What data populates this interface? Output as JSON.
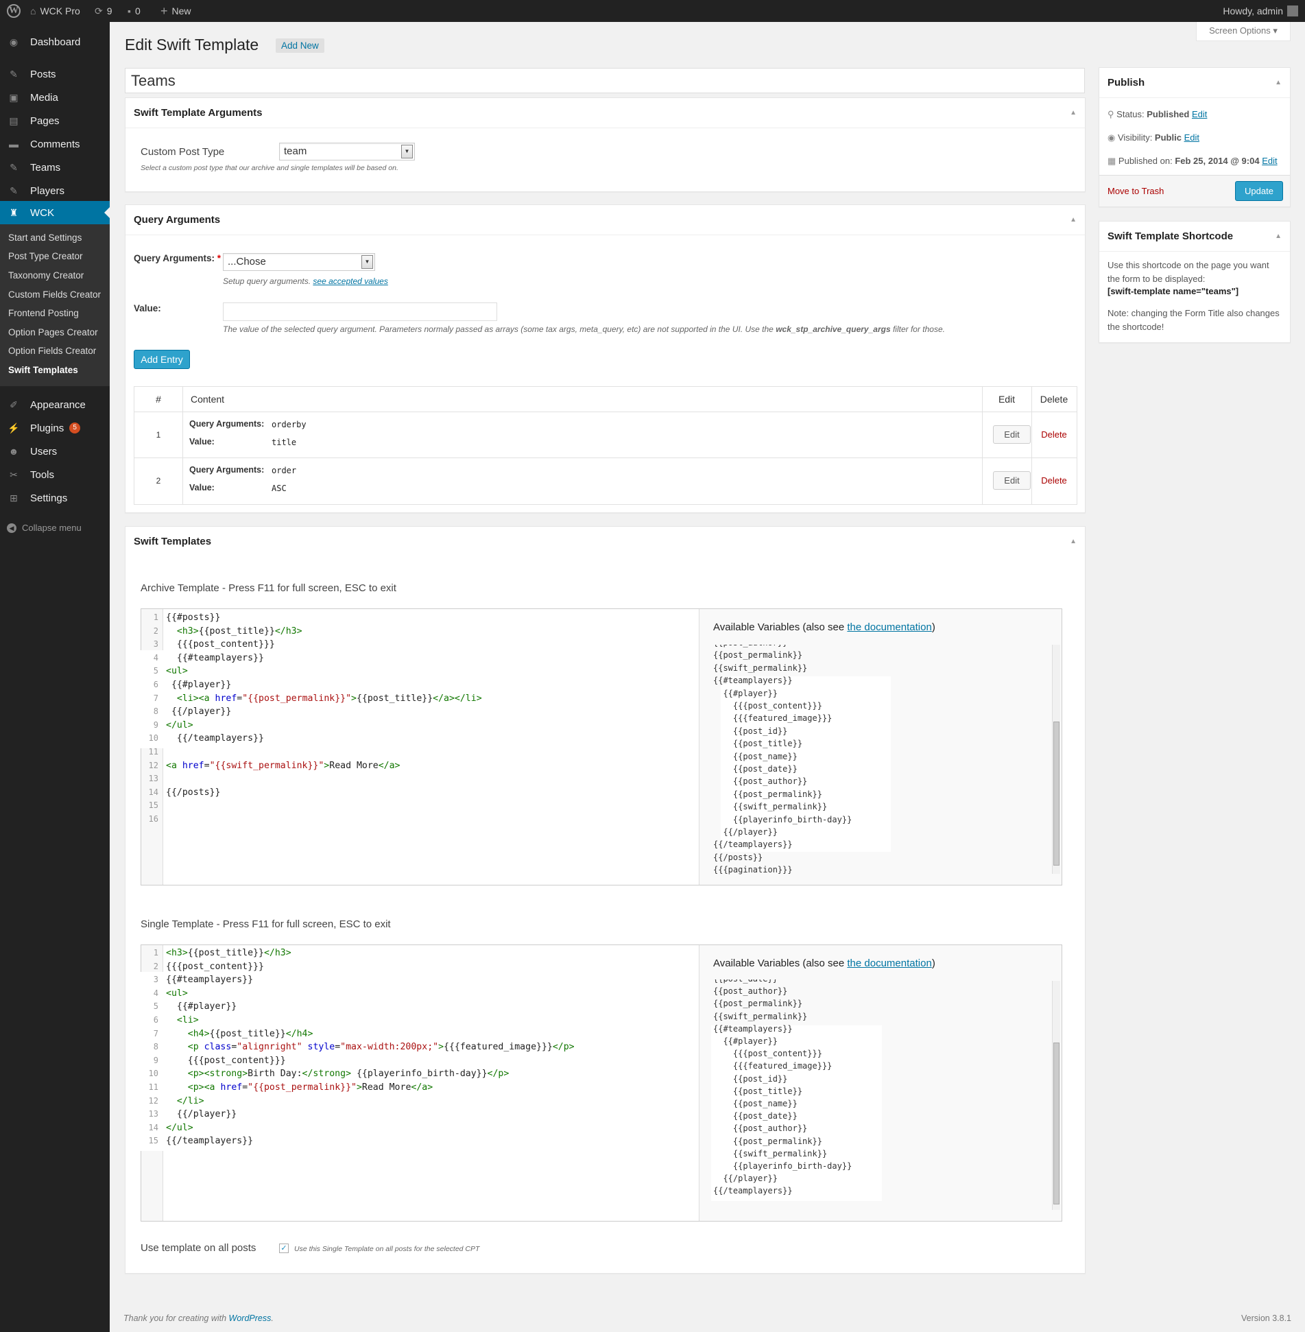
{
  "admin_bar": {
    "site_name": "WCK Pro",
    "updates_count": "9",
    "comments_count": "0",
    "new_label": "New",
    "howdy": "Howdy, admin"
  },
  "sidebar": {
    "items": [
      {
        "label": "Dashboard",
        "icon": "dashboard-icon"
      },
      {
        "label": "Posts",
        "icon": "pin-icon"
      },
      {
        "label": "Media",
        "icon": "media-icon"
      },
      {
        "label": "Pages",
        "icon": "pages-icon"
      },
      {
        "label": "Comments",
        "icon": "comment-icon"
      },
      {
        "label": "Teams",
        "icon": "pin-icon"
      },
      {
        "label": "Players",
        "icon": "pin-icon"
      },
      {
        "label": "WCK",
        "icon": "wck-icon"
      }
    ],
    "submenu": [
      "Start and Settings",
      "Post Type Creator",
      "Taxonomy Creator",
      "Custom Fields Creator",
      "Frontend Posting",
      "Option Pages Creator",
      "Option Fields Creator",
      "Swift Templates"
    ],
    "items_after": [
      {
        "label": "Appearance",
        "icon": "brush-icon"
      },
      {
        "label": "Plugins",
        "icon": "plugin-icon",
        "badge": "5"
      },
      {
        "label": "Users",
        "icon": "users-icon"
      },
      {
        "label": "Tools",
        "icon": "tools-icon"
      },
      {
        "label": "Settings",
        "icon": "settings-icon"
      }
    ],
    "collapse": "Collapse menu"
  },
  "header": {
    "title": "Edit Swift Template",
    "add_new": "Add New",
    "screen_options": "Screen Options"
  },
  "post_title": "Teams",
  "template_args": {
    "title": "Swift Template Arguments",
    "cpt_label": "Custom Post Type",
    "cpt_value": "team",
    "cpt_desc": "Select a custom post type that our archive and single templates will be based on."
  },
  "query_args": {
    "title": "Query Arguments",
    "field_label": "Query Arguments:",
    "required": "*",
    "select_value": "...Chose",
    "desc_prefix": "Setup query arguments. ",
    "desc_link": "see accepted values",
    "value_label": "Value:",
    "value_desc_a": "The value of the selected query argument. Parameters normaly passed as arrays (some tax args, meta_query, etc) are not supported in the UI. Use the ",
    "value_desc_b": "wck_stp_archive_query_args",
    "value_desc_c": " filter for those.",
    "add_entry": "Add Entry",
    "table_headers": [
      "#",
      "Content",
      "Edit",
      "Delete"
    ],
    "rows": [
      {
        "num": "1",
        "arg_label": "Query Arguments:",
        "arg": "orderby",
        "val_label": "Value:",
        "val": "title",
        "edit": "Edit",
        "delete": "Delete"
      },
      {
        "num": "2",
        "arg_label": "Query Arguments:",
        "arg": "order",
        "val_label": "Value:",
        "val": "ASC",
        "edit": "Edit",
        "delete": "Delete"
      }
    ]
  },
  "swift_templates": {
    "title": "Swift Templates",
    "archive_label": "Archive Template - Press F11 for full screen, ESC to exit",
    "single_label": "Single Template - Press F11 for full screen, ESC to exit",
    "vars_prefix": "Available Variables (also see ",
    "vars_link": "the documentation",
    "vars_suffix": ")",
    "use_all_label": "Use template on all posts",
    "use_all_desc": "Use this Single Template on all posts for the selected CPT"
  },
  "archive_code": [
    "{{#posts}}",
    "  <h3>{{post_title}}</h3>",
    "  {{{post_content}}}",
    "  {{#teamplayers}}",
    "<ul>",
    " {{#player}}",
    "  <li><a href=\"{{post_permalink}}\">{{post_title}}</a></li>",
    " {{/player}}",
    "</ul>",
    "  {{/teamplayers}}",
    "",
    "<a href=\"{{swift_permalink}}\">Read More</a>",
    "",
    "{{/posts}}",
    "",
    ""
  ],
  "archive_vars": [
    "{{post_author}}",
    "{{post_permalink}}",
    "{{swift_permalink}}",
    "{{#teamplayers}}",
    "  {{#player}}",
    "    {{{post_content}}}",
    "    {{{featured_image}}}",
    "    {{post_id}}",
    "    {{post_title}}",
    "    {{post_name}}",
    "    {{post_date}}",
    "    {{post_author}}",
    "    {{post_permalink}}",
    "    {{swift_permalink}}",
    "    {{playerinfo_birth-day}}",
    "  {{/player}}",
    "{{/teamplayers}}",
    "{{/posts}}",
    "{{{pagination}}}"
  ],
  "single_code": [
    "<h3>{{post_title}}</h3>",
    "{{{post_content}}}",
    "{{#teamplayers}}",
    "<ul>",
    "  {{#player}}",
    "  <li>",
    "    <h4>{{post_title}}</h4>",
    "    <p class=\"alignright\" style=\"max-width:200px;\">{{{featured_image}}}</p>",
    "    {{{post_content}}}",
    "    <p><strong>Birth Day:</strong> {{playerinfo_birth-day}}</p>",
    "    <p><a href=\"{{post_permalink}}\">Read More</a>",
    "  </li>",
    "  {{/player}}",
    "</ul>",
    "{{/teamplayers}}"
  ],
  "single_vars": [
    "{{post_date}}",
    "{{post_author}}",
    "{{post_permalink}}",
    "{{swift_permalink}}",
    "{{#teamplayers}}",
    "  {{#player}}",
    "    {{{post_content}}}",
    "    {{{featured_image}}}",
    "    {{post_id}}",
    "    {{post_title}}",
    "    {{post_name}}",
    "    {{post_date}}",
    "    {{post_author}}",
    "    {{post_permalink}}",
    "    {{swift_permalink}}",
    "    {{playerinfo_birth-day}}",
    "  {{/player}}",
    "{{/teamplayers}}"
  ],
  "publish": {
    "title": "Publish",
    "status_label": "Status: ",
    "status_value": "Published",
    "visibility_label": "Visibility: ",
    "visibility_value": "Public",
    "published_label": "Published on: ",
    "published_value": "Feb 25, 2014 @ 9:04",
    "edit": "Edit",
    "trash": "Move to Trash",
    "update": "Update"
  },
  "shortcode": {
    "title": "Swift Template Shortcode",
    "text1": "Use this shortcode on the page you want the form to be displayed:",
    "code": "[swift-template name=\"teams\"]",
    "text2": "Note: changing the Form Title also changes the shortcode!"
  },
  "footer": {
    "text": "Thank you for creating with ",
    "link": "WordPress",
    "end": ".",
    "version": "Version 3.8.1"
  },
  "colors": {
    "primary": "#2ea2cc",
    "link": "#0074a2",
    "delete": "#a00",
    "sidebar": "#222",
    "current": "#0074a2"
  }
}
